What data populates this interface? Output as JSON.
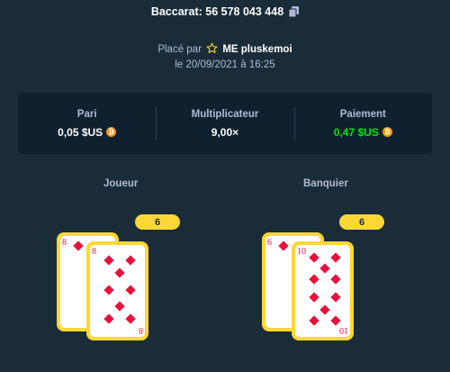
{
  "header": {
    "title": "Baccarat: 56 578 043 448",
    "copy_icon": "copy-icon"
  },
  "placed": {
    "prefix": "Placé par",
    "user": "ME pluskemoi",
    "date": "le 20/09/2021 à 16:25"
  },
  "stats": {
    "bet_label": "Pari",
    "bet_value": "0,05 $US",
    "multiplier_label": "Multiplicateur",
    "multiplier_value": "9,00×",
    "payout_label": "Paiement",
    "payout_value": "0,47 $US",
    "coin_icon": "bitcoin-icon",
    "payout_color": "#00e701"
  },
  "player": {
    "label": "Joueur",
    "total": "6",
    "cards": [
      {
        "rank": "8",
        "suit": "diamonds"
      },
      {
        "rank": "8",
        "suit": "diamonds"
      }
    ]
  },
  "banker": {
    "label": "Banquier",
    "total": "6",
    "cards": [
      {
        "rank": "6",
        "suit": "diamonds"
      },
      {
        "rank": "10",
        "suit": "diamonds"
      }
    ]
  },
  "colors": {
    "background": "#1a2c38",
    "panel": "#0f212e",
    "card_border": "#fdd835",
    "suit_red": "#e9113c"
  }
}
